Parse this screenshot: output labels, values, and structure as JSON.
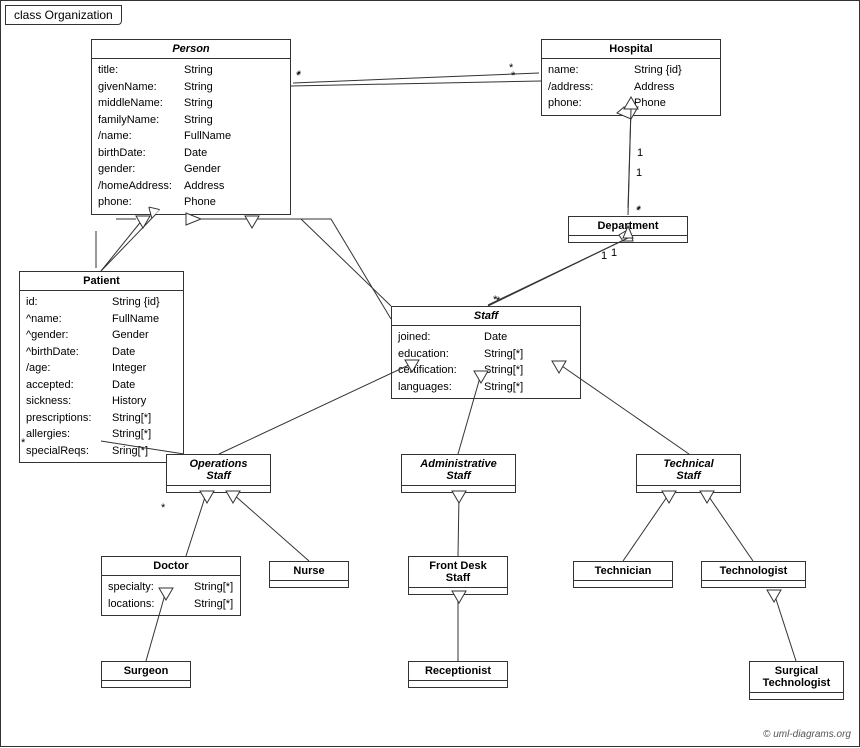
{
  "title": "class Organization",
  "copyright": "© uml-diagrams.org",
  "classes": {
    "person": {
      "name": "Person",
      "italic": true,
      "attrs": [
        {
          "name": "title:",
          "type": "String"
        },
        {
          "name": "givenName:",
          "type": "String"
        },
        {
          "name": "middleName:",
          "type": "String"
        },
        {
          "name": "familyName:",
          "type": "String"
        },
        {
          "name": "/name:",
          "type": "FullName"
        },
        {
          "name": "birthDate:",
          "type": "Date"
        },
        {
          "name": "gender:",
          "type": "Gender"
        },
        {
          "name": "/homeAddress:",
          "type": "Address"
        },
        {
          "name": "phone:",
          "type": "Phone"
        }
      ]
    },
    "hospital": {
      "name": "Hospital",
      "italic": false,
      "attrs": [
        {
          "name": "name:",
          "type": "String {id}"
        },
        {
          "name": "/address:",
          "type": "Address"
        },
        {
          "name": "phone:",
          "type": "Phone"
        }
      ]
    },
    "department": {
      "name": "Department",
      "italic": false,
      "attrs": []
    },
    "staff": {
      "name": "Staff",
      "italic": true,
      "attrs": [
        {
          "name": "joined:",
          "type": "Date"
        },
        {
          "name": "education:",
          "type": "String[*]"
        },
        {
          "name": "certification:",
          "type": "String[*]"
        },
        {
          "name": "languages:",
          "type": "String[*]"
        }
      ]
    },
    "patient": {
      "name": "Patient",
      "italic": false,
      "attrs": [
        {
          "name": "id:",
          "type": "String {id}"
        },
        {
          "name": "^name:",
          "type": "FullName"
        },
        {
          "name": "^gender:",
          "type": "Gender"
        },
        {
          "name": "^birthDate:",
          "type": "Date"
        },
        {
          "name": "/age:",
          "type": "Integer"
        },
        {
          "name": "accepted:",
          "type": "Date"
        },
        {
          "name": "sickness:",
          "type": "History"
        },
        {
          "name": "prescriptions:",
          "type": "String[*]"
        },
        {
          "name": "allergies:",
          "type": "String[*]"
        },
        {
          "name": "specialReqs:",
          "type": "Sring[*]"
        }
      ]
    },
    "operations_staff": {
      "name": "Operations\nStaff",
      "italic": true,
      "attrs": []
    },
    "administrative_staff": {
      "name": "Administrative\nStaff",
      "italic": true,
      "attrs": []
    },
    "technical_staff": {
      "name": "Technical\nStaff",
      "italic": true,
      "attrs": []
    },
    "doctor": {
      "name": "Doctor",
      "italic": false,
      "attrs": [
        {
          "name": "specialty:",
          "type": "String[*]"
        },
        {
          "name": "locations:",
          "type": "String[*]"
        }
      ]
    },
    "nurse": {
      "name": "Nurse",
      "italic": false,
      "attrs": []
    },
    "front_desk_staff": {
      "name": "Front Desk\nStaff",
      "italic": false,
      "attrs": []
    },
    "technician": {
      "name": "Technician",
      "italic": false,
      "attrs": []
    },
    "technologist": {
      "name": "Technologist",
      "italic": false,
      "attrs": []
    },
    "surgeon": {
      "name": "Surgeon",
      "italic": false,
      "attrs": []
    },
    "receptionist": {
      "name": "Receptionist",
      "italic": false,
      "attrs": []
    },
    "surgical_technologist": {
      "name": "Surgical\nTechnologist",
      "italic": false,
      "attrs": []
    }
  }
}
